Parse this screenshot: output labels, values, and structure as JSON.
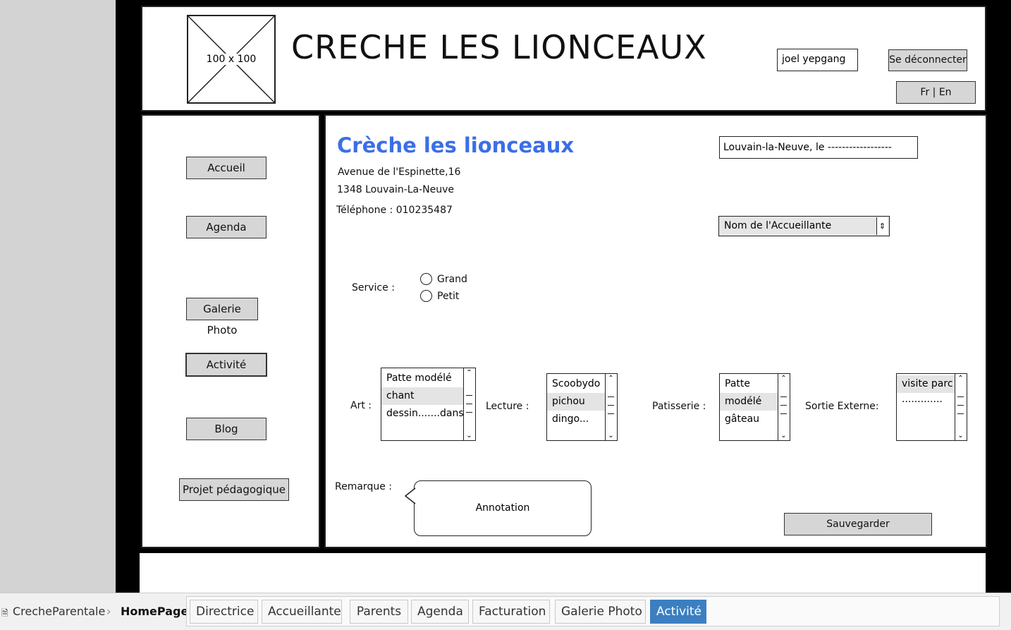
{
  "header": {
    "logo_text": "100 x 100",
    "site_title": "CRECHE LES LIONCEAUX",
    "user_name": "joel yepgang",
    "logout_label": "Se déconnecter",
    "language_label": "Fr | En"
  },
  "sidebar": {
    "items": [
      {
        "label": "Accueil"
      },
      {
        "label": "Agenda"
      },
      {
        "label": "Galerie Photo"
      },
      {
        "label": "Activité"
      },
      {
        "label": "Blog"
      },
      {
        "label": "Projet pédagogique"
      }
    ],
    "active_item": "Activité"
  },
  "main": {
    "org_name": "Crèche les lionceaux",
    "address_line1": "Avenue de l'Espinette,16",
    "address_line2": "1348 Louvain-La-Neuve",
    "phone": "Téléphone : 010235487",
    "date_field": "Louvain-la-Neuve, le ------------------",
    "caregiver_select": "Nom de l'Accueillante",
    "service": {
      "label": "Service :",
      "options": [
        "Grand",
        "Petit"
      ]
    },
    "art": {
      "label": "Art  :",
      "items": [
        "Patte modélé",
        "chant",
        "dessin.......danse"
      ],
      "selected": "chant"
    },
    "lecture": {
      "label": "Lecture :",
      "items": [
        "Scoobydo",
        "pichou",
        "dingo..."
      ],
      "selected": "pichou"
    },
    "patisserie": {
      "label": "Patisserie :",
      "items": [
        "Patte",
        "modélé",
        "gâteau"
      ],
      "selected": "modélé"
    },
    "sortie": {
      "label": "Sortie Externe:",
      "items": [
        "visite parc",
        "............."
      ],
      "selected": "visite parc"
    },
    "remarque_label": "Remarque :",
    "annotation": "Annotation",
    "save_label": "Sauvegarder"
  },
  "bottom_bar": {
    "breadcrumb": [
      "CrecheParentale",
      "HomePage"
    ],
    "tabs": [
      "Directrice",
      "Accueillante",
      "Parents",
      "Agenda",
      "Facturation",
      "Galerie Photo",
      "Activité"
    ],
    "active_tab": "Activité"
  },
  "colors": {
    "accent_title": "#3b6ee8",
    "active_tab": "#3c7fc1",
    "button_fill": "#d6d6d6"
  }
}
